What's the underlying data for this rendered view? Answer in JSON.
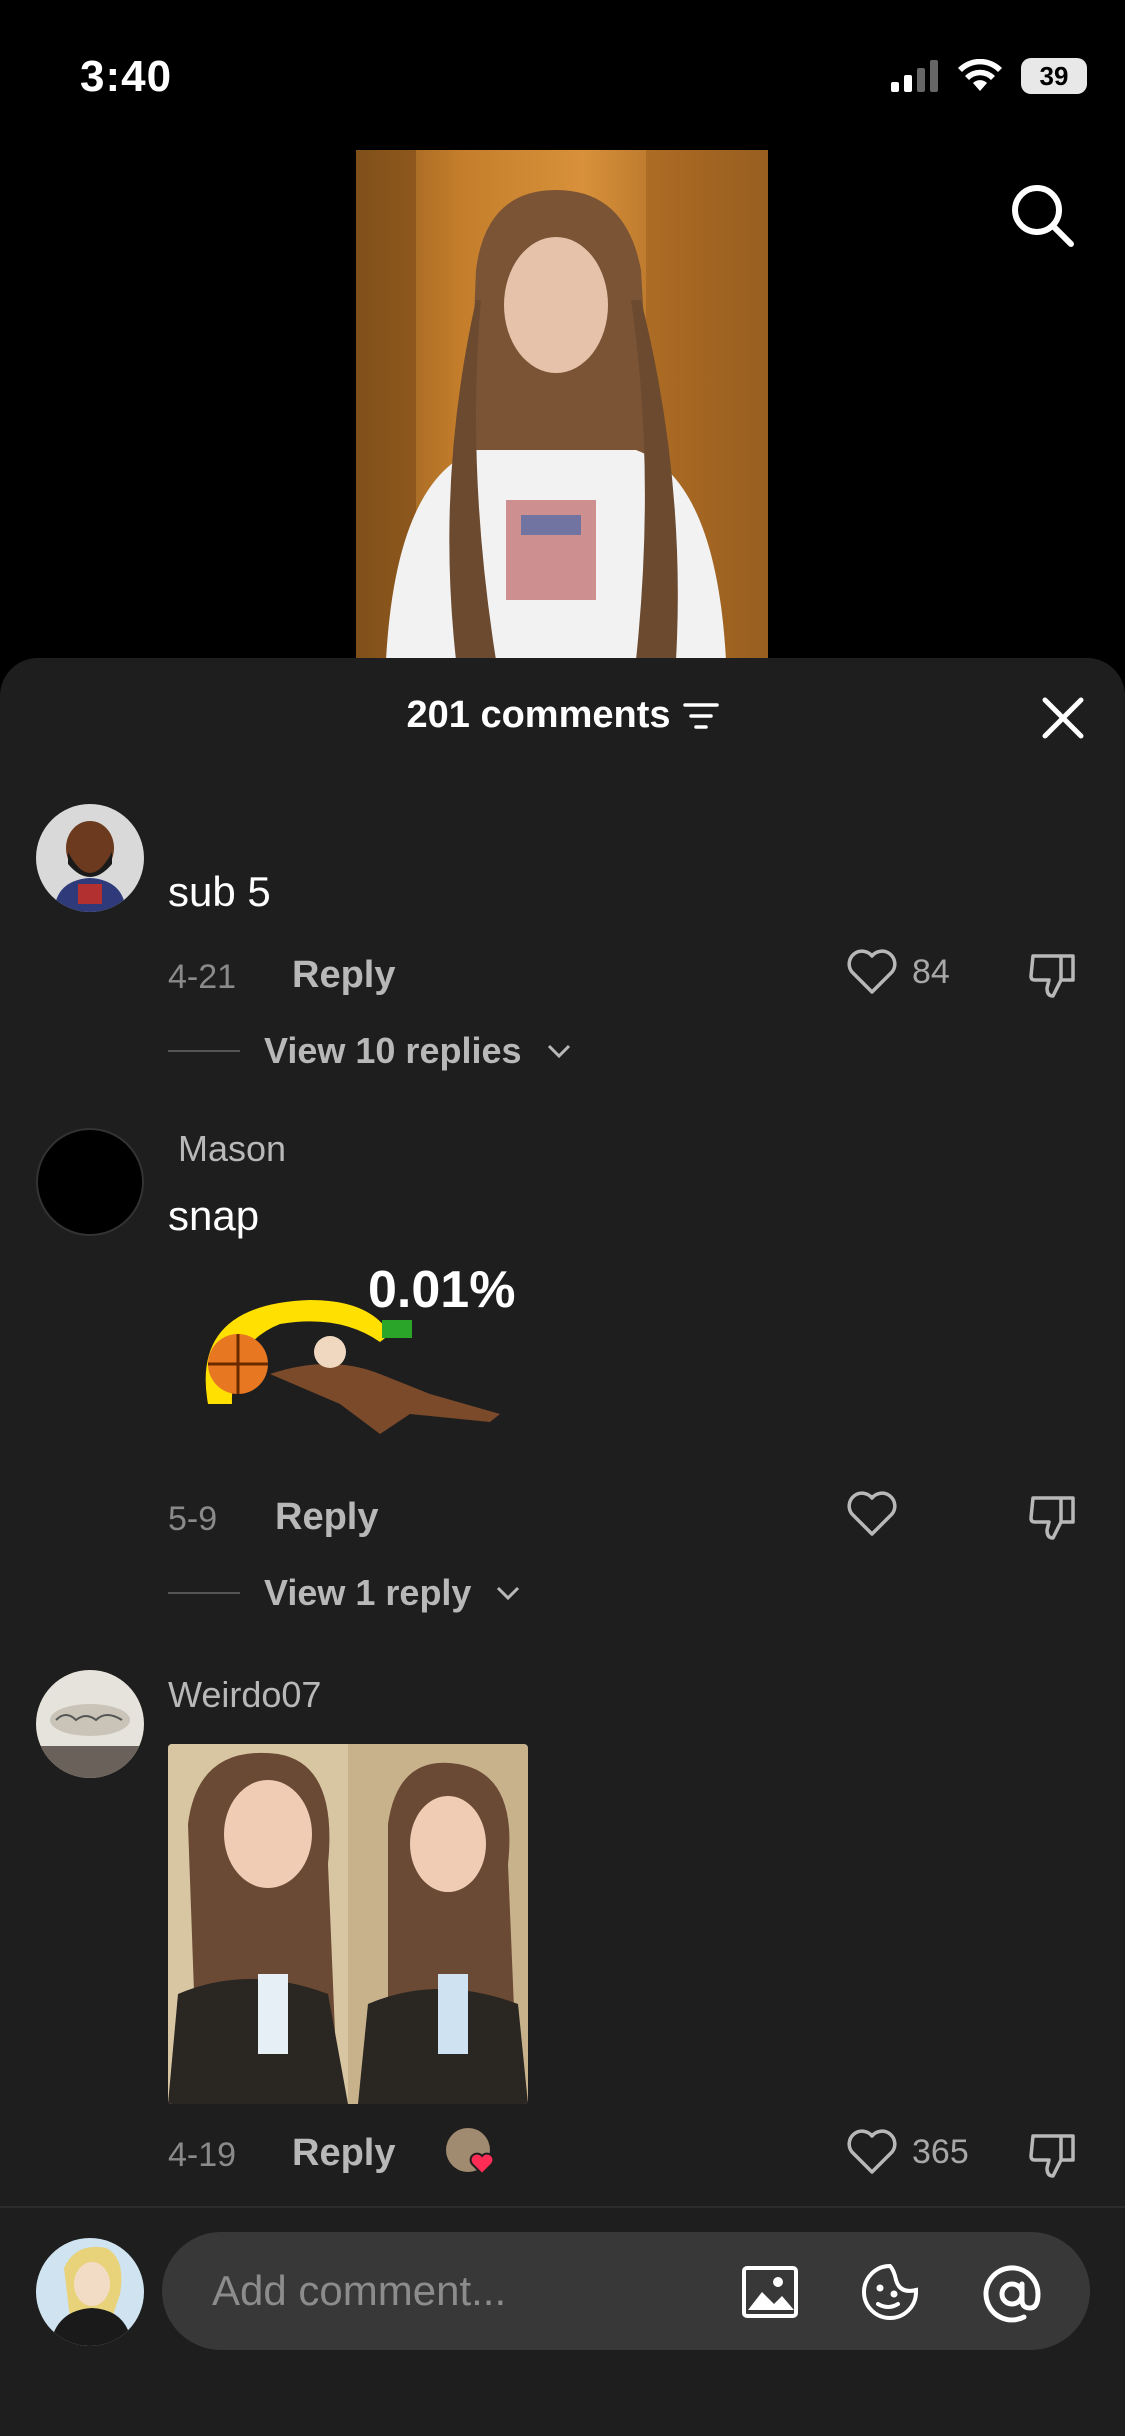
{
  "status": {
    "time": "3:40",
    "battery": "39"
  },
  "comments_header": {
    "title": "201 comments"
  },
  "comments": [
    {
      "username": "",
      "text": "sub 5",
      "date": "4-21",
      "reply_label": "Reply",
      "likes": "84",
      "view_replies": "View 10 replies"
    },
    {
      "username": "Mason",
      "text": "snap",
      "sticker_text": "0.01%",
      "date": "5-9",
      "reply_label": "Reply",
      "likes": "",
      "view_replies": "View 1 reply"
    },
    {
      "username": "Weirdo07",
      "date": "4-19",
      "reply_label": "Reply",
      "likes": "365"
    }
  ],
  "input": {
    "placeholder": "Add comment..."
  },
  "colors": {
    "sheet_bg": "#1e1e1e",
    "like_heart": "#ff2d55",
    "sticker_yellow": "#ffe000"
  }
}
